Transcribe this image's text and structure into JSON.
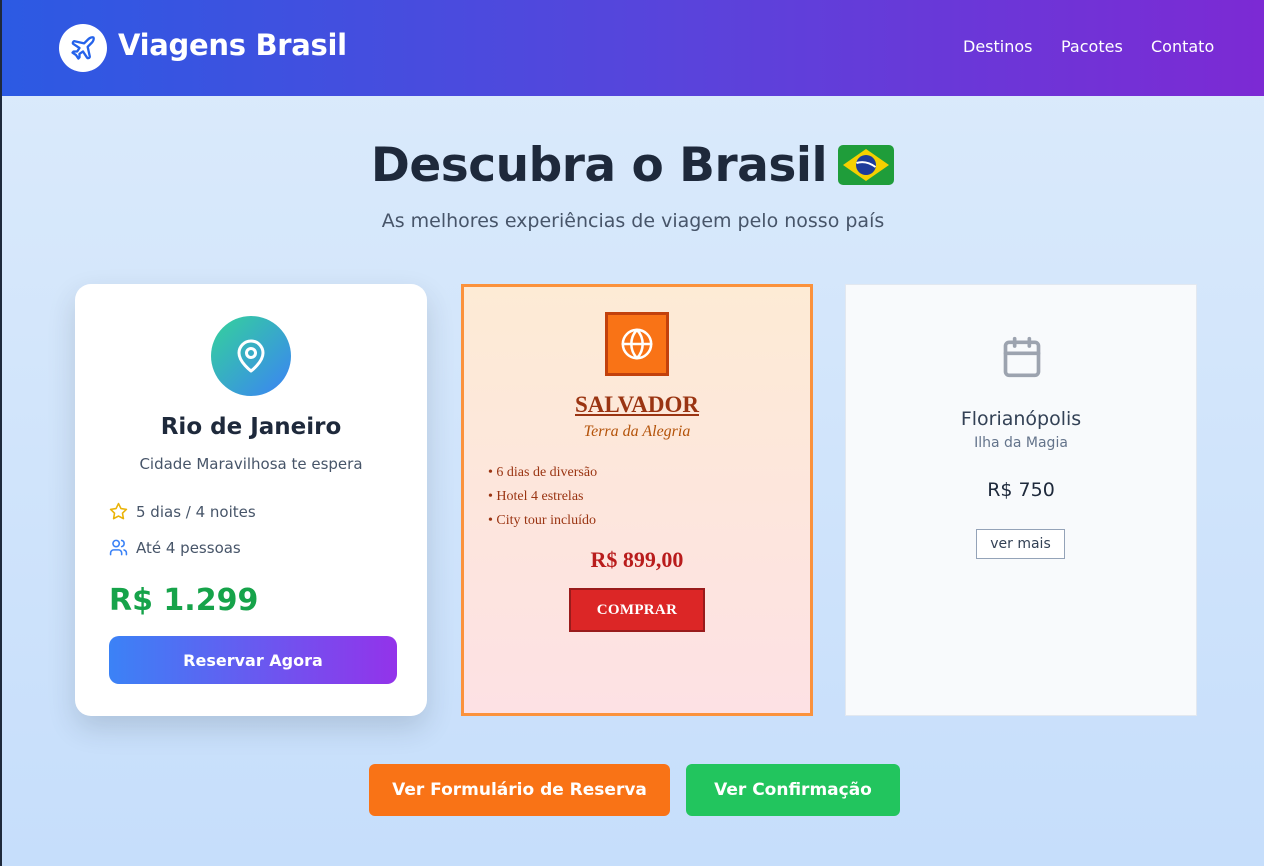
{
  "header": {
    "brand": "Viagens Brasil",
    "nav": [
      "Destinos",
      "Pacotes",
      "Contato"
    ]
  },
  "hero": {
    "title": "Descubra o Brasil",
    "subtitle": "As melhores experiências de viagem pelo nosso país"
  },
  "cards": [
    {
      "icon": "map-pin-icon",
      "title": "Rio de Janeiro",
      "subtitle": "Cidade Maravilhosa te espera",
      "features": [
        "5 dias / 4 noites",
        "Até 4 pessoas"
      ],
      "price": "R$ 1.299",
      "button": "Reservar Agora"
    },
    {
      "icon": "globe-icon",
      "title": "SALVADOR",
      "subtitle": "Terra da Alegria",
      "features": [
        "• 6 dias de diversão",
        "• Hotel 4 estrelas",
        "• City tour incluído"
      ],
      "price": "R$ 899,00",
      "button": "COMPRAR"
    },
    {
      "icon": "calendar-icon",
      "title": "Florianópolis",
      "subtitle": "Ilha da Magia",
      "price": "R$ 750",
      "button": "ver mais"
    }
  ],
  "actions": {
    "form": "Ver Formulário de Reserva",
    "confirm": "Ver Confirmação"
  },
  "colors": {
    "header_start": "#2c5ae3",
    "header_end": "#7c2ad4",
    "price_green": "#16a34a",
    "salvador_red": "#dc2626",
    "orange": "#f97316",
    "green": "#22c55e"
  }
}
